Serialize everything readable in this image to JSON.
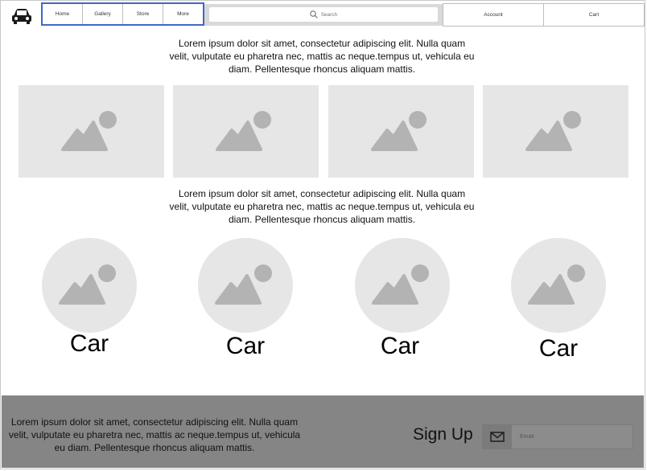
{
  "nav": {
    "items": [
      {
        "label": "Home"
      },
      {
        "label": "Gallery"
      },
      {
        "label": "Store"
      },
      {
        "label": "More"
      }
    ]
  },
  "search": {
    "placeholder": "Search"
  },
  "account_label": "Account",
  "cart_label": "Cart",
  "intro_text": "Lorem ipsum dolor sit amet, consectetur adipiscing elit. Nulla quam velit, vulputate eu pharetra nec, mattis ac neque.tempus ut, vehicula eu diam. Pellentesque rhoncus aliquam mattis.",
  "second_text": "Lorem ipsum dolor sit amet, consectetur adipiscing elit. Nulla quam velit, vulputate eu pharetra nec, mattis ac neque.tempus ut, vehicula eu diam. Pellentesque rhoncus aliquam mattis.",
  "cars": [
    {
      "label": "Car"
    },
    {
      "label": "Car"
    },
    {
      "label": "Car"
    },
    {
      "label": "Car"
    }
  ],
  "footer": {
    "text": "Lorem ipsum dolor sit amet, consectetur adipiscing elit. Nulla quam velit, vulputate eu pharetra nec, mattis ac neque.tempus ut, vehicula eu diam. Pellentesque rhoncus aliquam mattis.",
    "signup_label": "Sign Up",
    "email_placeholder": "Email"
  },
  "icons": {
    "logo": "car-icon",
    "search": "search-icon",
    "image": "image-placeholder-icon",
    "email": "mail-icon"
  },
  "colors": {
    "nav_border": "#3d68c9",
    "placeholder_bg": "#e6e6e6",
    "placeholder_glyph": "#b3b3b3",
    "footer_bg": "#858585"
  }
}
